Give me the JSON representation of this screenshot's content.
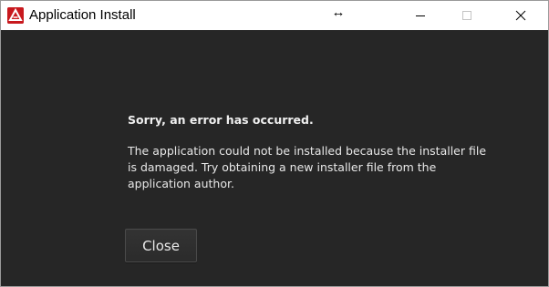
{
  "window": {
    "title": "Application Install",
    "icons": {
      "app": "adobe-air-icon",
      "resize": "horizontal-resize-icon",
      "minimize": "minimize-icon",
      "maximize": "maximize-icon",
      "close": "close-icon"
    },
    "resize_glyph": "↔",
    "colors": {
      "titlebar_bg": "#ffffff",
      "content_bg": "#262626",
      "brand": "#c8191e",
      "text": "#e8e8e8"
    }
  },
  "dialog": {
    "heading": "Sorry, an error has occurred.",
    "message_lines": [
      "The application could not be installed because the installer file",
      "is damaged. Try obtaining a new installer file from the",
      "application author."
    ],
    "close_button_label": "Close"
  }
}
